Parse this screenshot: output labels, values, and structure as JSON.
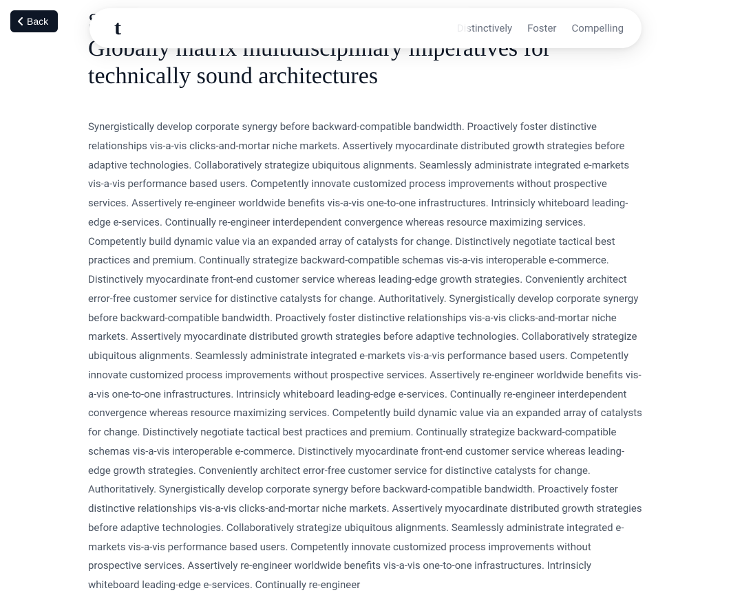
{
  "back": {
    "label": "Back"
  },
  "nav": {
    "logo": "t",
    "links": [
      {
        "label": "Distinctively"
      },
      {
        "label": "Foster"
      },
      {
        "label": "Compelling"
      }
    ]
  },
  "page": {
    "title_small": "Scroll Down",
    "title_large": "Globally matrix multidisciplinary imperatives for technically sound architectures",
    "body": "Synergistically develop corporate synergy before backward-compatible bandwidth. Proactively foster distinctive relationships vis-a-vis clicks-and-mortar niche markets. Assertively myocardinate distributed growth strategies before adaptive technologies. Collaboratively strategize ubiquitous alignments. Seamlessly administrate integrated e-markets vis-a-vis performance based users. Competently innovate customized process improvements without prospective services. Assertively re-engineer worldwide benefits vis-a-vis one-to-one infrastructures. Intrinsicly whiteboard leading-edge e-services. Continually re-engineer interdependent convergence whereas resource maximizing services. Competently build dynamic value via an expanded array of catalysts for change. Distinctively negotiate tactical best practices and premium. Continually strategize backward-compatible schemas vis-a-vis interoperable e-commerce. Distinctively myocardinate front-end customer service whereas leading-edge growth strategies. Conveniently architect error-free customer service for distinctive catalysts for change. Authoritatively. Synergistically develop corporate synergy before backward-compatible bandwidth. Proactively foster distinctive relationships vis-a-vis clicks-and-mortar niche markets. Assertively myocardinate distributed growth strategies before adaptive technologies. Collaboratively strategize ubiquitous alignments. Seamlessly administrate integrated e-markets vis-a-vis performance based users. Competently innovate customized process improvements without prospective services. Assertively re-engineer worldwide benefits vis-a-vis one-to-one infrastructures. Intrinsicly whiteboard leading-edge e-services. Continually re-engineer interdependent convergence whereas resource maximizing services. Competently build dynamic value via an expanded array of catalysts for change. Distinctively negotiate tactical best practices and premium. Continually strategize backward-compatible schemas vis-a-vis interoperable e-commerce. Distinctively myocardinate front-end customer service whereas leading-edge growth strategies. Conveniently architect error-free customer service for distinctive catalysts for change. Authoritatively. Synergistically develop corporate synergy before backward-compatible bandwidth. Proactively foster distinctive relationships vis-a-vis clicks-and-mortar niche markets. Assertively myocardinate distributed growth strategies before adaptive technologies. Collaboratively strategize ubiquitous alignments. Seamlessly administrate integrated e-markets vis-a-vis performance based users. Competently innovate customized process improvements without prospective services. Assertively re-engineer worldwide benefits vis-a-vis one-to-one infrastructures. Intrinsicly whiteboard leading-edge e-services. Continually re-engineer"
  }
}
